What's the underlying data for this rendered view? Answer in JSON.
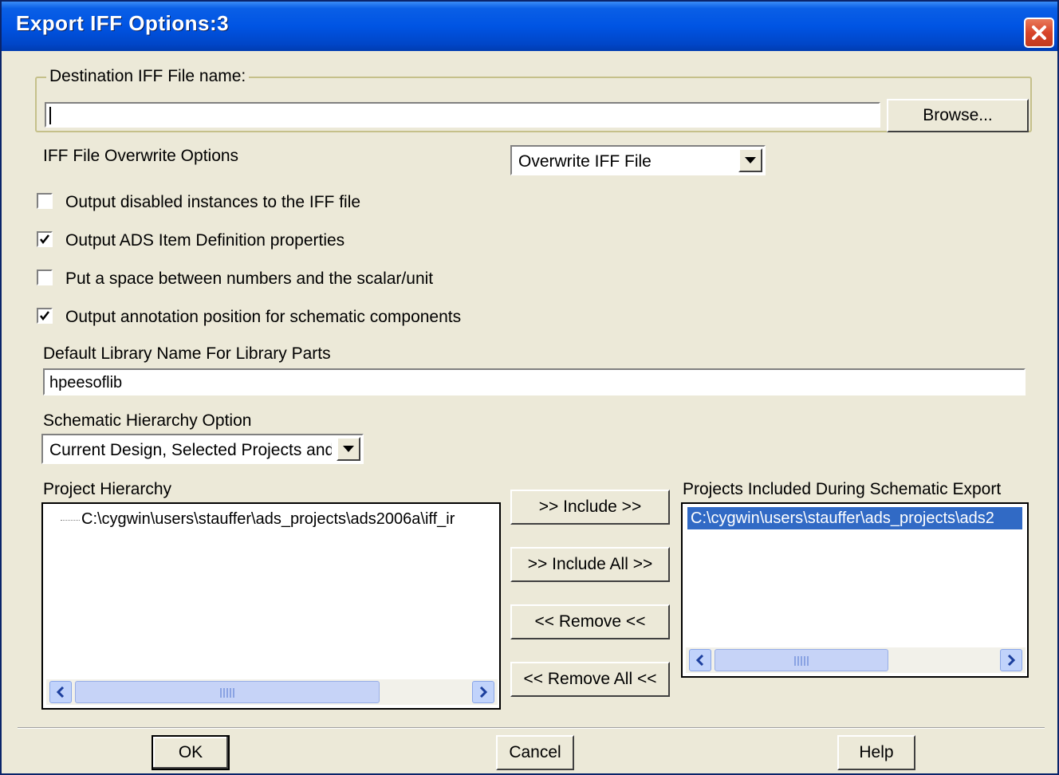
{
  "window": {
    "title": "Export IFF Options:3"
  },
  "destination": {
    "group_label": "Destination IFF File name:",
    "value": "",
    "browse_label": "Browse..."
  },
  "overwrite": {
    "label": "IFF File Overwrite Options",
    "selected": "Overwrite IFF File"
  },
  "checkboxes": [
    {
      "label": "Output disabled instances to the IFF file",
      "checked": false
    },
    {
      "label": "Output ADS Item Definition properties",
      "checked": true
    },
    {
      "label": "Put a space between numbers and the scalar/unit",
      "checked": false
    },
    {
      "label": "Output annotation position for schematic components",
      "checked": true
    }
  ],
  "default_library": {
    "label": "Default Library Name For Library Parts",
    "value": "hpeesoflib"
  },
  "hierarchy_option": {
    "label": "Schematic Hierarchy Option",
    "selected": "Current Design, Selected Projects and"
  },
  "project_hierarchy": {
    "label": "Project Hierarchy",
    "items": [
      "C:\\cygwin\\users\\stauffer\\ads_projects\\ads2006a\\iff_ir"
    ]
  },
  "buttons": {
    "include": ">> Include >>",
    "include_all": ">> Include All >>",
    "remove": "<< Remove <<",
    "remove_all": "<< Remove All <<"
  },
  "projects_included": {
    "label": "Projects Included During Schematic Export",
    "items": [
      "C:\\cygwin\\users\\stauffer\\ads_projects\\ads2"
    ]
  },
  "footer": {
    "ok": "OK",
    "cancel": "Cancel",
    "help": "Help"
  },
  "colors": {
    "titlebar": "#0054e3",
    "face": "#ece9d8",
    "selection": "#316ac5",
    "close": "#d8452a"
  }
}
